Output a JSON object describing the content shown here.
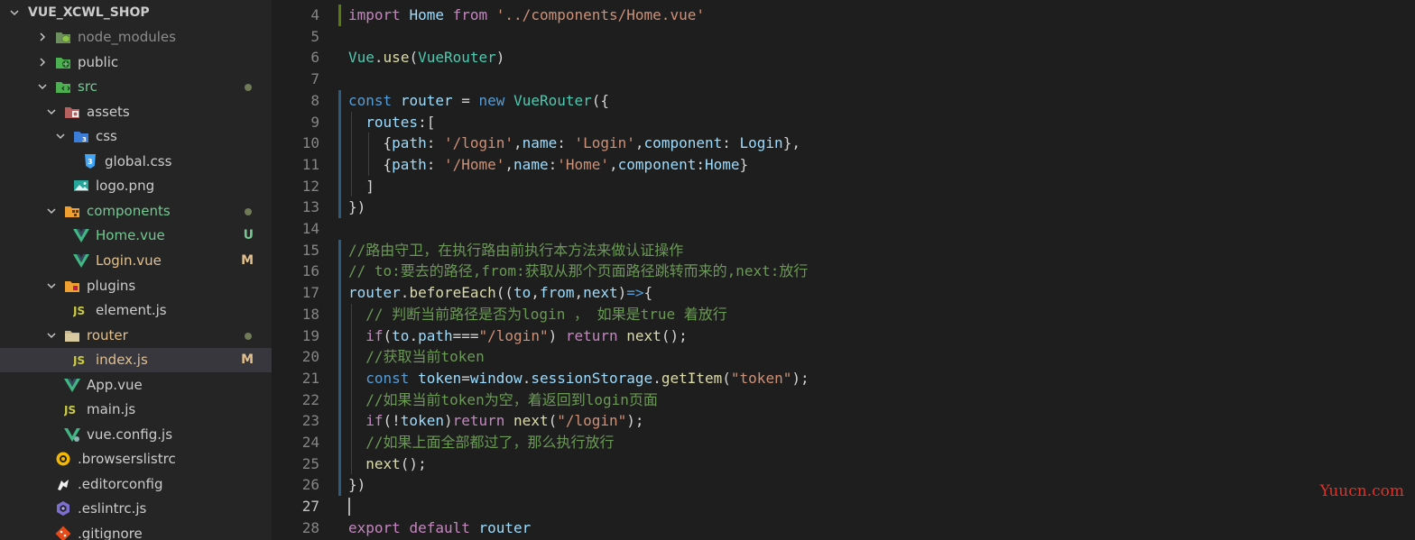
{
  "colors": {
    "modified": "#d7b87a",
    "untracked": "#73c991",
    "dot": "#6f7a56",
    "folder_green": "#8bc34a",
    "vue_green": "#41b883",
    "js_yellow": "#cbcb41",
    "css_blue": "#42a5f5"
  },
  "explorer": {
    "root_label": "VUE_XCWL_SHOP",
    "items": [
      {
        "label": "node_modules",
        "depth": 1,
        "kind": "folder",
        "expanded": false,
        "icon": "node-modules-folder-icon",
        "color": "#8c8c8c"
      },
      {
        "label": "public",
        "depth": 1,
        "kind": "folder",
        "expanded": false,
        "icon": "public-folder-icon",
        "color": "#cccccc"
      },
      {
        "label": "src",
        "depth": 1,
        "kind": "folder",
        "expanded": true,
        "icon": "src-folder-icon",
        "color": "#73c991",
        "dot": true
      },
      {
        "label": "assets",
        "depth": 2,
        "kind": "folder",
        "expanded": true,
        "icon": "assets-folder-icon",
        "color": "#cccccc"
      },
      {
        "label": "css",
        "depth": 3,
        "kind": "folder",
        "expanded": true,
        "icon": "css-folder-icon",
        "color": "#cccccc"
      },
      {
        "label": "global.css",
        "depth": 4,
        "kind": "file",
        "icon": "css-file-icon",
        "color": "#cccccc"
      },
      {
        "label": "logo.png",
        "depth": 3,
        "kind": "file",
        "icon": "image-file-icon",
        "color": "#cccccc"
      },
      {
        "label": "components",
        "depth": 2,
        "kind": "folder",
        "expanded": true,
        "icon": "components-folder-icon",
        "color": "#73c991",
        "dot": true
      },
      {
        "label": "Home.vue",
        "depth": 3,
        "kind": "file",
        "icon": "vue-file-icon",
        "color": "#73c991",
        "badge": "U"
      },
      {
        "label": "Login.vue",
        "depth": 3,
        "kind": "file",
        "icon": "vue-file-icon",
        "color": "#e2c08d",
        "badge": "M"
      },
      {
        "label": "plugins",
        "depth": 2,
        "kind": "folder",
        "expanded": true,
        "icon": "plugins-folder-icon",
        "color": "#cccccc"
      },
      {
        "label": "element.js",
        "depth": 3,
        "kind": "file",
        "icon": "js-file-icon",
        "color": "#cccccc"
      },
      {
        "label": "router",
        "depth": 2,
        "kind": "folder",
        "expanded": true,
        "icon": "router-folder-icon",
        "color": "#e2c08d",
        "dot": true
      },
      {
        "label": "index.js",
        "depth": 3,
        "kind": "file",
        "icon": "js-file-icon",
        "color": "#e2c08d",
        "badge": "M",
        "selected": true
      },
      {
        "label": "App.vue",
        "depth": 2,
        "kind": "file",
        "icon": "vue-file-icon",
        "color": "#cccccc"
      },
      {
        "label": "main.js",
        "depth": 2,
        "kind": "file",
        "icon": "js-file-icon",
        "color": "#cccccc"
      },
      {
        "label": "vue.config.js",
        "depth": 2,
        "kind": "file",
        "icon": "vue-config-file-icon",
        "color": "#cccccc"
      },
      {
        "label": ".browserslistrc",
        "depth": 1,
        "kind": "file",
        "icon": "browserslist-file-icon",
        "color": "#cccccc"
      },
      {
        "label": ".editorconfig",
        "depth": 1,
        "kind": "file",
        "icon": "editorconfig-file-icon",
        "color": "#cccccc"
      },
      {
        "label": ".eslintrc.js",
        "depth": 1,
        "kind": "file",
        "icon": "eslint-file-icon",
        "color": "#cccccc"
      },
      {
        "label": ".gitignore",
        "depth": 1,
        "kind": "file",
        "icon": "git-file-icon",
        "color": "#cccccc"
      }
    ]
  },
  "editor": {
    "lines": [
      {
        "n": "4",
        "tokens": [
          [
            "kw2",
            "import"
          ],
          [
            "pun",
            " "
          ],
          [
            "var",
            "Home"
          ],
          [
            "pun",
            " "
          ],
          [
            "kw2",
            "from"
          ],
          [
            "pun",
            " "
          ],
          [
            "str",
            "'../components/Home.vue'"
          ]
        ]
      },
      {
        "n": "5",
        "tokens": []
      },
      {
        "n": "6",
        "tokens": [
          [
            "cls",
            "Vue"
          ],
          [
            "pun",
            "."
          ],
          [
            "fn",
            "use"
          ],
          [
            "pun",
            "("
          ],
          [
            "cls",
            "VueRouter"
          ],
          [
            "pun",
            ")"
          ]
        ]
      },
      {
        "n": "7",
        "tokens": []
      },
      {
        "n": "8",
        "tokens": [
          [
            "kw",
            "const"
          ],
          [
            "pun",
            " "
          ],
          [
            "var",
            "router"
          ],
          [
            "pun",
            " = "
          ],
          [
            "kw",
            "new"
          ],
          [
            "pun",
            " "
          ],
          [
            "cls",
            "VueRouter"
          ],
          [
            "pun",
            "({"
          ]
        ]
      },
      {
        "n": "9",
        "tokens": [
          [
            "pun",
            "  "
          ],
          [
            "var",
            "routes"
          ],
          [
            "pun",
            ":["
          ]
        ]
      },
      {
        "n": "10",
        "tokens": [
          [
            "pun",
            "    {"
          ],
          [
            "var",
            "path"
          ],
          [
            "pun",
            ": "
          ],
          [
            "str",
            "'/login'"
          ],
          [
            "pun",
            ","
          ],
          [
            "var",
            "name"
          ],
          [
            "pun",
            ": "
          ],
          [
            "str",
            "'Login'"
          ],
          [
            "pun",
            ","
          ],
          [
            "var",
            "component"
          ],
          [
            "pun",
            ": "
          ],
          [
            "var",
            "Login"
          ],
          [
            "pun",
            "},"
          ]
        ]
      },
      {
        "n": "11",
        "tokens": [
          [
            "pun",
            "    {"
          ],
          [
            "var",
            "path"
          ],
          [
            "pun",
            ": "
          ],
          [
            "str",
            "'/Home'"
          ],
          [
            "pun",
            ","
          ],
          [
            "var",
            "name"
          ],
          [
            "pun",
            ":"
          ],
          [
            "str",
            "'Home'"
          ],
          [
            "pun",
            ","
          ],
          [
            "var",
            "component"
          ],
          [
            "pun",
            ":"
          ],
          [
            "var",
            "Home"
          ],
          [
            "pun",
            "}"
          ]
        ]
      },
      {
        "n": "12",
        "tokens": [
          [
            "pun",
            "  ]"
          ]
        ]
      },
      {
        "n": "13",
        "tokens": [
          [
            "pun",
            "})"
          ]
        ]
      },
      {
        "n": "14",
        "tokens": []
      },
      {
        "n": "15",
        "tokens": [
          [
            "com",
            "//路由守卫，在执行路由前执行本方法来做认证操作"
          ]
        ]
      },
      {
        "n": "16",
        "tokens": [
          [
            "com",
            "// to:要去的路径,from:获取从那个页面路径跳转而来的,next:放行"
          ]
        ]
      },
      {
        "n": "17",
        "tokens": [
          [
            "var",
            "router"
          ],
          [
            "pun",
            "."
          ],
          [
            "fn",
            "beforeEach"
          ],
          [
            "pun",
            "(("
          ],
          [
            "var",
            "to"
          ],
          [
            "pun",
            ","
          ],
          [
            "var",
            "from"
          ],
          [
            "pun",
            ","
          ],
          [
            "var",
            "next"
          ],
          [
            "pun",
            ")"
          ],
          [
            "kw",
            "=>"
          ],
          [
            "pun",
            "{"
          ]
        ]
      },
      {
        "n": "18",
        "tokens": [
          [
            "pun",
            "  "
          ],
          [
            "com",
            "// 判断当前路径是否为login ， 如果是true 着放行"
          ]
        ]
      },
      {
        "n": "19",
        "tokens": [
          [
            "pun",
            "  "
          ],
          [
            "kw2",
            "if"
          ],
          [
            "pun",
            "("
          ],
          [
            "var",
            "to"
          ],
          [
            "pun",
            "."
          ],
          [
            "var",
            "path"
          ],
          [
            "pun",
            "==="
          ],
          [
            "str",
            "\"/login\""
          ],
          [
            "pun",
            ") "
          ],
          [
            "kw2",
            "return"
          ],
          [
            "pun",
            " "
          ],
          [
            "fn",
            "next"
          ],
          [
            "pun",
            "();"
          ]
        ]
      },
      {
        "n": "20",
        "tokens": [
          [
            "pun",
            "  "
          ],
          [
            "com",
            "//获取当前token"
          ]
        ]
      },
      {
        "n": "21",
        "tokens": [
          [
            "pun",
            "  "
          ],
          [
            "kw",
            "const"
          ],
          [
            "pun",
            " "
          ],
          [
            "var",
            "token"
          ],
          [
            "pun",
            "="
          ],
          [
            "var",
            "window"
          ],
          [
            "pun",
            "."
          ],
          [
            "var",
            "sessionStorage"
          ],
          [
            "pun",
            "."
          ],
          [
            "fn",
            "getItem"
          ],
          [
            "pun",
            "("
          ],
          [
            "str",
            "\"token\""
          ],
          [
            "pun",
            ");"
          ]
        ]
      },
      {
        "n": "22",
        "tokens": [
          [
            "pun",
            "  "
          ],
          [
            "com",
            "//如果当前token为空，着返回到login页面"
          ]
        ]
      },
      {
        "n": "23",
        "tokens": [
          [
            "pun",
            "  "
          ],
          [
            "kw2",
            "if"
          ],
          [
            "pun",
            "(!"
          ],
          [
            "var",
            "token"
          ],
          [
            "pun",
            ")"
          ],
          [
            "kw2",
            "return"
          ],
          [
            "pun",
            " "
          ],
          [
            "fn",
            "next"
          ],
          [
            "pun",
            "("
          ],
          [
            "str",
            "\"/login\""
          ],
          [
            "pun",
            ");"
          ]
        ]
      },
      {
        "n": "24",
        "tokens": [
          [
            "pun",
            "  "
          ],
          [
            "com",
            "//如果上面全部都过了，那么执行放行"
          ]
        ]
      },
      {
        "n": "25",
        "tokens": [
          [
            "pun",
            "  "
          ],
          [
            "fn",
            "next"
          ],
          [
            "pun",
            "();"
          ]
        ]
      },
      {
        "n": "26",
        "tokens": [
          [
            "pun",
            "})"
          ]
        ]
      },
      {
        "n": "27",
        "tokens": [],
        "active": true
      },
      {
        "n": "28",
        "tokens": [
          [
            "kw2",
            "export"
          ],
          [
            "pun",
            " "
          ],
          [
            "kw2",
            "default"
          ],
          [
            "pun",
            " "
          ],
          [
            "var",
            "router"
          ]
        ]
      }
    ]
  },
  "watermark": "Yuucn.com"
}
